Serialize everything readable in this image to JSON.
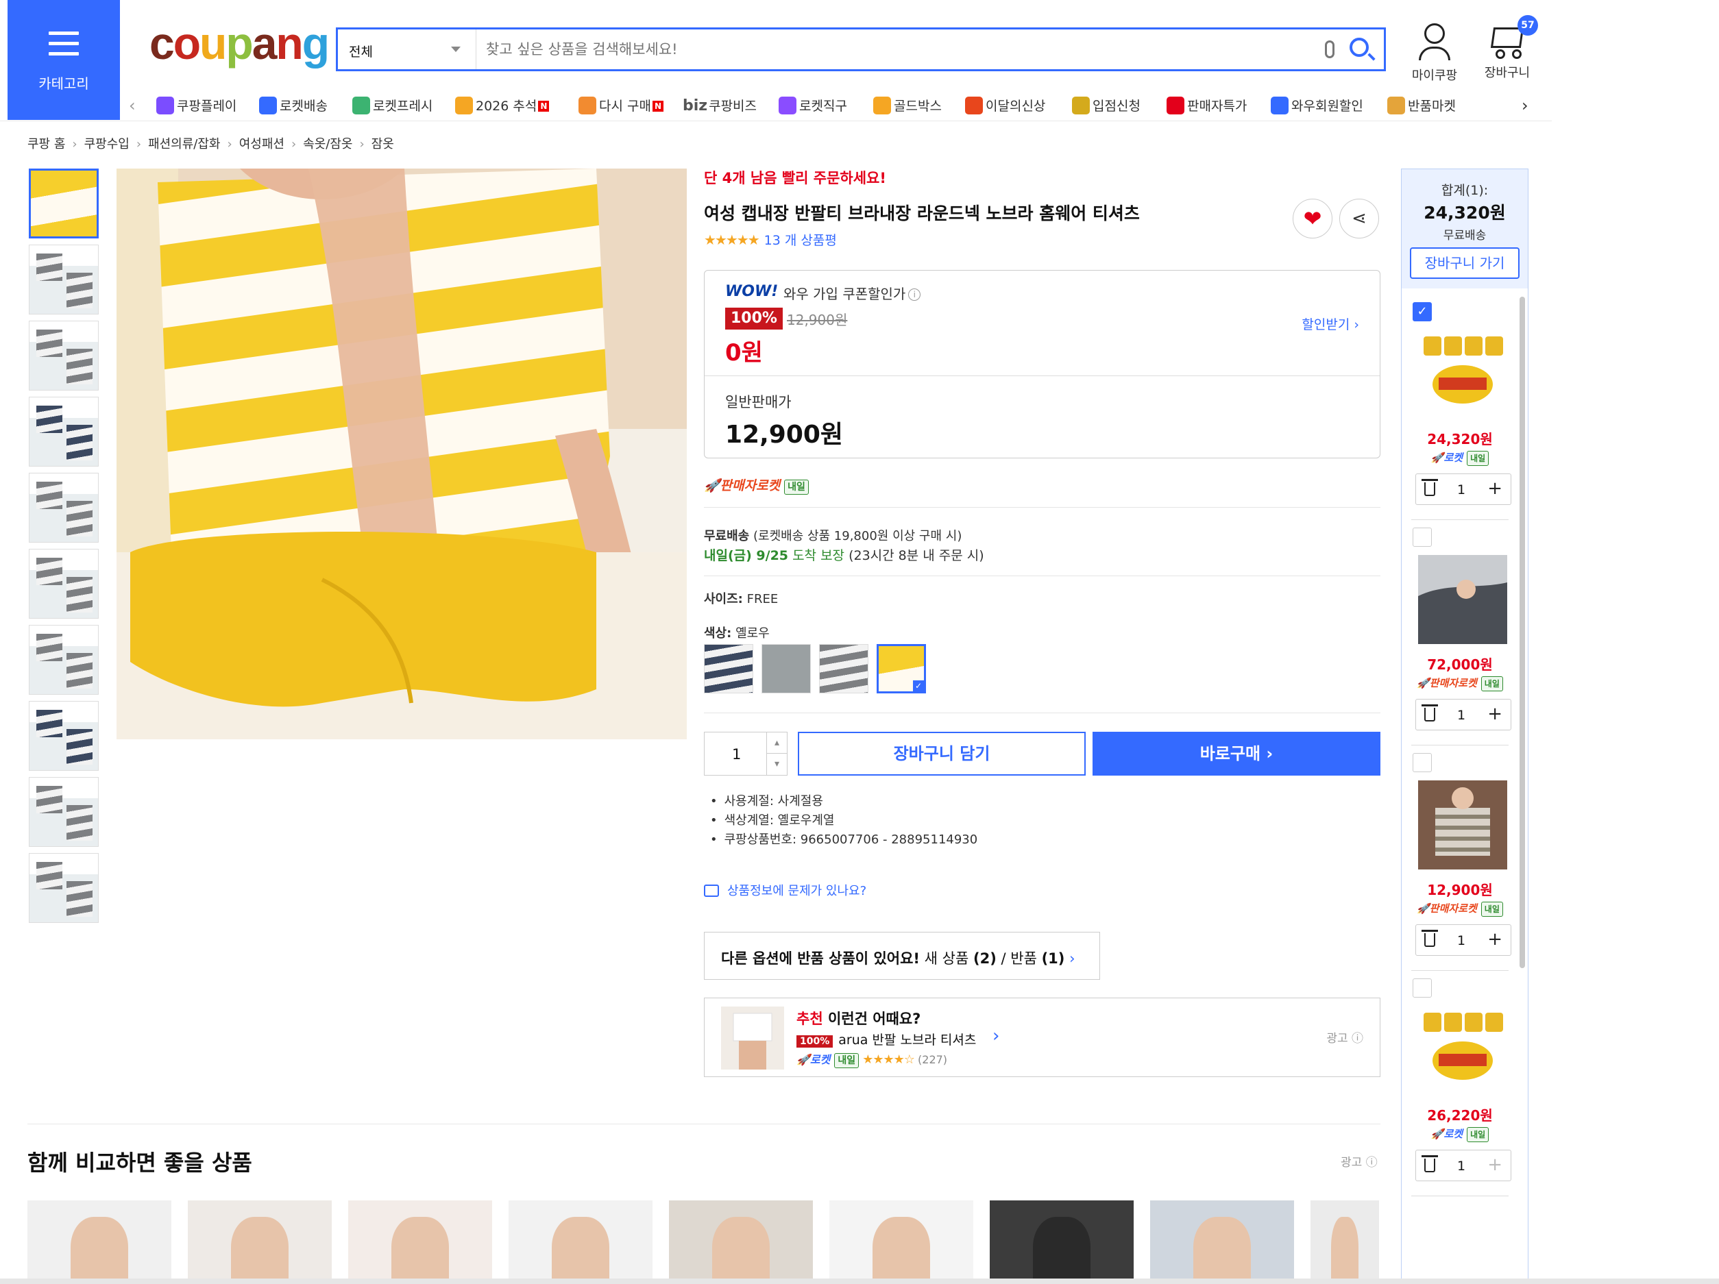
{
  "header": {
    "category_label": "카테고리",
    "search_scope": "전체",
    "search_placeholder": "찾고 싶은 상품을 검색해보세요!",
    "my_coupang": "마이쿠팡",
    "cart": "장바구니",
    "cart_count": "57"
  },
  "nav_items": [
    {
      "label": "쿠팡플레이",
      "icon": "play-icon",
      "color": "#7b4dff",
      "badge": ""
    },
    {
      "label": "로켓배송",
      "icon": "rocket-icon",
      "color": "#346aff",
      "badge": ""
    },
    {
      "label": "로켓프레시",
      "icon": "rocket-fresh-icon",
      "color": "#3cb371",
      "badge": ""
    },
    {
      "label": "2026 추석",
      "icon": "moon-icon",
      "color": "#f5a623",
      "badge": "N"
    },
    {
      "label": "다시 구매",
      "icon": "home-icon",
      "color": "#f28b30",
      "badge": "N"
    },
    {
      "label": "쿠팡비즈",
      "icon": "biz-icon",
      "color": "#333333",
      "badge": "",
      "prefix": "biz"
    },
    {
      "label": "로켓직구",
      "icon": "globe-icon",
      "color": "#8a4dff",
      "badge": ""
    },
    {
      "label": "골드박스",
      "icon": "gift-box-icon",
      "color": "#f5a623",
      "badge": ""
    },
    {
      "label": "이달의신상",
      "icon": "new-bag-icon",
      "color": "#e8461c",
      "badge": ""
    },
    {
      "label": "입점신청",
      "icon": "store-icon",
      "color": "#d4aa1c",
      "badge": ""
    },
    {
      "label": "판매자특가",
      "icon": "percent-icon",
      "color": "#e3001b",
      "badge": ""
    },
    {
      "label": "와우회원할인",
      "icon": "wow-icon",
      "color": "#346aff",
      "badge": ""
    },
    {
      "label": "반품마켓",
      "icon": "return-market-icon",
      "color": "#e4a43a",
      "badge": ""
    }
  ],
  "breadcrumb": [
    "쿠팡 홈",
    "쿠팡수입",
    "패션의류/잡화",
    "여성패션",
    "속옷/잠옷",
    "잠옷"
  ],
  "product": {
    "urgency": "단 4개 남음 빨리 주문하세요!",
    "title": "여성 캡내장 반팔티 브라내장 라운드넥 노브라 홈웨어 티셔츠",
    "stars": "★★★★★",
    "review_count": "13 개 상품평",
    "wow_logo": "WOW!",
    "wow_label": "와우 가입 쿠폰할인가",
    "discount_pct": "100%",
    "original_price": "12,900원",
    "wow_price": "0원",
    "coupon_link": "할인받기",
    "normal_label": "일반판매가",
    "normal_price": "12,900원",
    "seller_rocket": "판매자로켓",
    "tomorrow_badge": "내일",
    "free_shipping": "무료배송",
    "shipping_note": "(로켓배송 상품 19,800원 이상 구매 시)",
    "arrival_day": "내일(금) 9/25",
    "arrival_guarantee": "도착 보장",
    "arrival_note": "(23시간 8분 내 주문 시)",
    "size_label": "사이즈:",
    "size_value": "FREE",
    "color_label": "색상:",
    "color_value": "옐로우",
    "quantity": "1",
    "add_to_cart": "장바구니 담기",
    "buy_now": "바로구매",
    "specs": [
      "사용계절: 사계절용",
      "색상계열: 옐로우계열",
      "쿠팡상품번호: 9665007706 - 28895114930"
    ],
    "report_link": "상품정보에 문제가 있나요?",
    "other_option_bold": "다른 옵션에 반품 상품이 있어요!",
    "other_option_new": "새 상품",
    "other_option_new_count": "(2)",
    "other_option_return": "반품",
    "other_option_return_count": "(1)"
  },
  "recommend": {
    "head_red": "추천",
    "head_rest": "이런건 어때요?",
    "badge": "100%",
    "name": "arua 반팔 노브라 티셔츠",
    "rocket": "로켓",
    "tomorrow": "내일",
    "stars": "★★★★☆",
    "count": "(227)",
    "ad": "광고"
  },
  "compare": {
    "title": "함께 비교하면 좋을 상품",
    "ad": "광고"
  },
  "sidebar": {
    "sum_label": "합계(1):",
    "total": "24,320원",
    "free": "무료배송",
    "go_cart": "장바구니 가기",
    "items": [
      {
        "price": "24,320원",
        "rocket": "로켓",
        "tomorrow": "내일",
        "qty": "1",
        "checked": true
      },
      {
        "price": "72,000원",
        "rocket": "판매자로켓",
        "tomorrow": "내일",
        "qty": "1",
        "checked": false
      },
      {
        "price": "12,900원",
        "rocket": "판매자로켓",
        "tomorrow": "내일",
        "qty": "1",
        "checked": false
      },
      {
        "price": "26,220원",
        "rocket": "로켓",
        "tomorrow": "내일",
        "qty": "1",
        "checked": false
      }
    ]
  },
  "colors": {
    "accent": "#346aff",
    "price_red": "#e3001b",
    "discount_red": "#c8161d",
    "green": "#2e8b2e"
  }
}
